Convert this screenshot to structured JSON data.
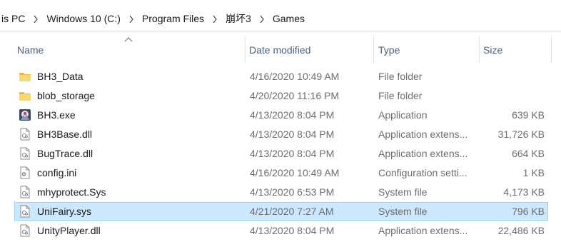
{
  "breadcrumb": {
    "items": [
      "is PC",
      "Windows 10 (C:)",
      "Program Files",
      "崩坏3",
      "Games"
    ]
  },
  "columns": {
    "name": "Name",
    "date_modified": "Date modified",
    "type": "Type",
    "size": "Size",
    "sort_column": "name",
    "sort_direction": "ascending"
  },
  "files": [
    {
      "name": "BH3_Data",
      "date": "4/16/2020 10:49 AM",
      "type": "File folder",
      "size": "",
      "icon": "folder-icon"
    },
    {
      "name": "blob_storage",
      "date": "4/20/2020 11:16 PM",
      "type": "File folder",
      "size": "",
      "icon": "folder-icon"
    },
    {
      "name": "BH3.exe",
      "date": "4/13/2020 8:04 PM",
      "type": "Application",
      "size": "639 KB",
      "icon": "app-icon"
    },
    {
      "name": "BH3Base.dll",
      "date": "4/13/2020 8:04 PM",
      "type": "Application extens...",
      "size": "31,726 KB",
      "icon": "dll-file-icon"
    },
    {
      "name": "BugTrace.dll",
      "date": "4/13/2020 8:04 PM",
      "type": "Application extens...",
      "size": "664 KB",
      "icon": "dll-file-icon"
    },
    {
      "name": "config.ini",
      "date": "4/16/2020 10:49 AM",
      "type": "Configuration setti...",
      "size": "1 KB",
      "icon": "config-file-icon"
    },
    {
      "name": "mhyprotect.Sys",
      "date": "4/13/2020 6:53 PM",
      "type": "System file",
      "size": "4,173 KB",
      "icon": "system-file-icon"
    },
    {
      "name": "UniFairy.sys",
      "date": "4/21/2020 7:27 AM",
      "type": "System file",
      "size": "796 KB",
      "icon": "system-file-icon",
      "selected": true
    },
    {
      "name": "UnityPlayer.dll",
      "date": "4/13/2020 8:04 PM",
      "type": "Application extens...",
      "size": "22,486 KB",
      "icon": "dll-file-icon"
    }
  ],
  "colors": {
    "selection_bg": "#cce8ff",
    "selection_border": "#99d1ff",
    "header_text": "#4c607a",
    "secondary_text": "#6d6d6d",
    "folder": "#f8d775"
  }
}
